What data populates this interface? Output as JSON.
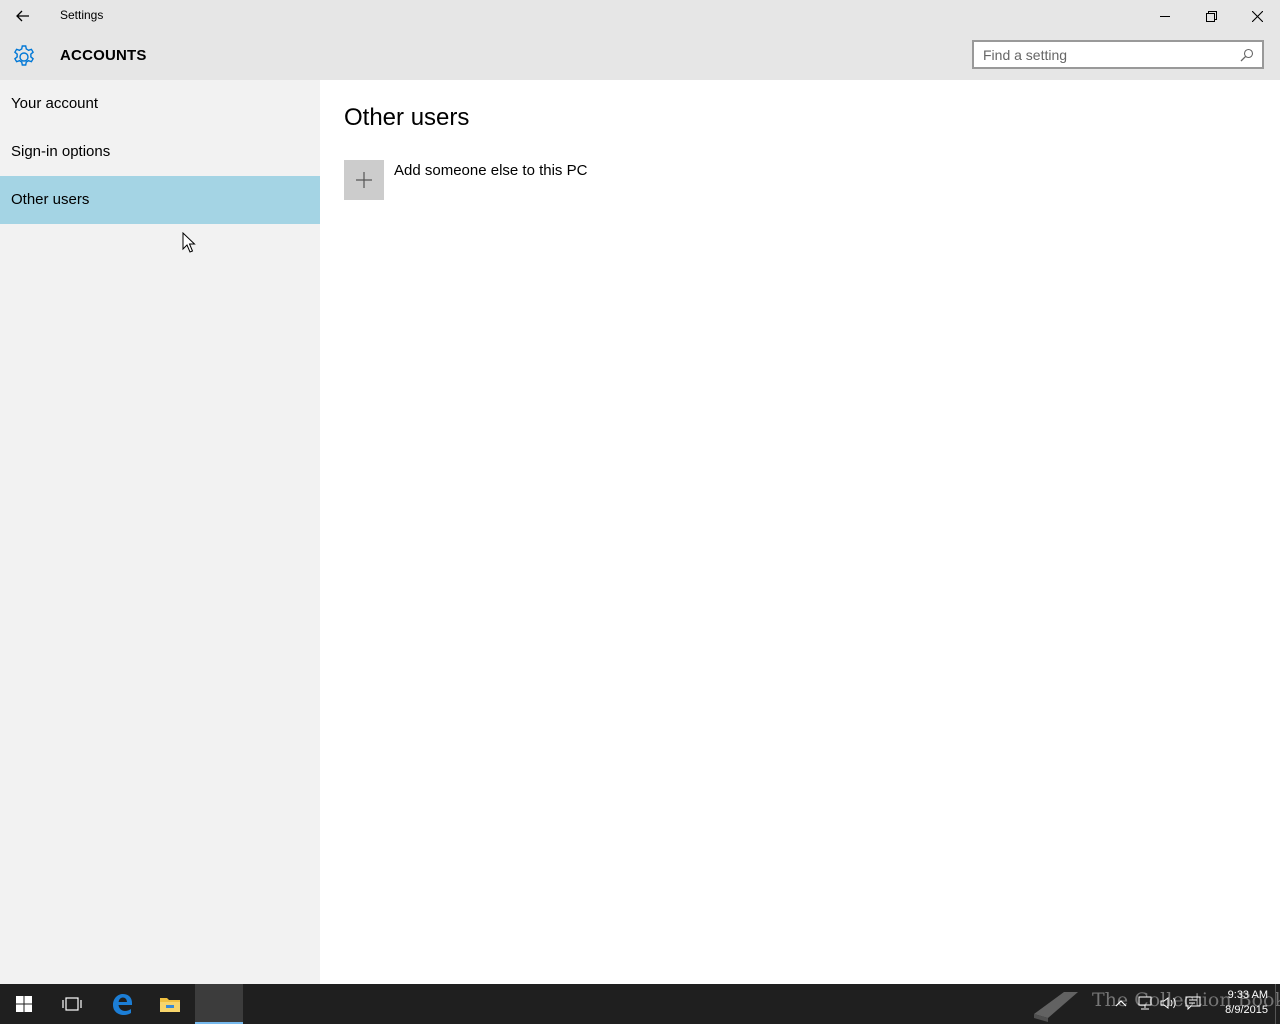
{
  "window": {
    "title": "Settings"
  },
  "header": {
    "section_title": "ACCOUNTS",
    "search_placeholder": "Find a setting"
  },
  "sidebar": {
    "items": [
      {
        "label": "Your account",
        "selected": false
      },
      {
        "label": "Sign-in options",
        "selected": false
      },
      {
        "label": "Other users",
        "selected": true
      }
    ]
  },
  "main": {
    "title": "Other users",
    "add_user_label": "Add someone else to this PC"
  },
  "taskbar": {
    "clock_time": "9:33 AM",
    "clock_date": "8/9/2015",
    "watermark": "The Collection Book",
    "icons": [
      "windows-start-icon",
      "task-view-icon",
      "edge-icon",
      "file-explorer-icon",
      "settings-app-icon"
    ]
  },
  "colors": {
    "accent": "#0078d7",
    "selected_nav": "#a4d4e4",
    "chrome": "#e6e6e6",
    "sidebar": "#f2f2f2",
    "taskbar": "#1f1f1f"
  }
}
